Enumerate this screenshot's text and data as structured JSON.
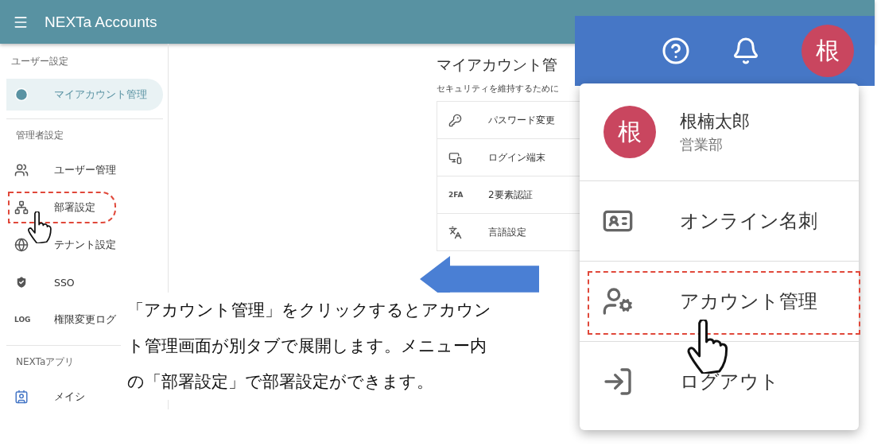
{
  "app": {
    "title": "NEXTa Accounts"
  },
  "sidebar": {
    "sections": [
      {
        "heading": "ユーザー設定",
        "items": [
          {
            "label": "マイアカウント管理",
            "selected": true,
            "highlighted": false
          }
        ]
      },
      {
        "heading": "管理者設定",
        "items": [
          {
            "label": "ユーザー管理",
            "selected": false,
            "highlighted": false
          },
          {
            "label": "部署設定",
            "selected": false,
            "highlighted": true
          },
          {
            "label": "テナント設定",
            "selected": false,
            "highlighted": false
          },
          {
            "label": "SSO",
            "selected": false,
            "highlighted": false
          },
          {
            "label": "権限変更ログ",
            "icon_text": "LOG",
            "selected": false,
            "highlighted": false
          }
        ]
      },
      {
        "heading": "NEXTaアプリ",
        "items": [
          {
            "label": "メイシ",
            "selected": false,
            "highlighted": false
          }
        ]
      }
    ]
  },
  "main": {
    "title": "マイアカウント管",
    "subtitle": "セキュリティを維持するために",
    "rows": [
      {
        "label": "パスワード変更"
      },
      {
        "label": "ログイン端末"
      },
      {
        "label": "2要素認証",
        "icon_text": "2FA"
      },
      {
        "label": "言語設定"
      }
    ]
  },
  "account_menu": {
    "avatar": "根",
    "user": {
      "avatar": "根",
      "name": "根楠太郎",
      "department": "営業部"
    },
    "items": [
      {
        "label": "オンライン名刺",
        "highlighted": false
      },
      {
        "label": "アカウント管理",
        "highlighted": true
      },
      {
        "label": "ログアウト",
        "highlighted": false
      }
    ]
  },
  "instruction": "「アカウント管理」をクリックするとアカウント管理画面が別タブで展開します。メニュー内の「部署設定」で部署設定ができます。"
}
